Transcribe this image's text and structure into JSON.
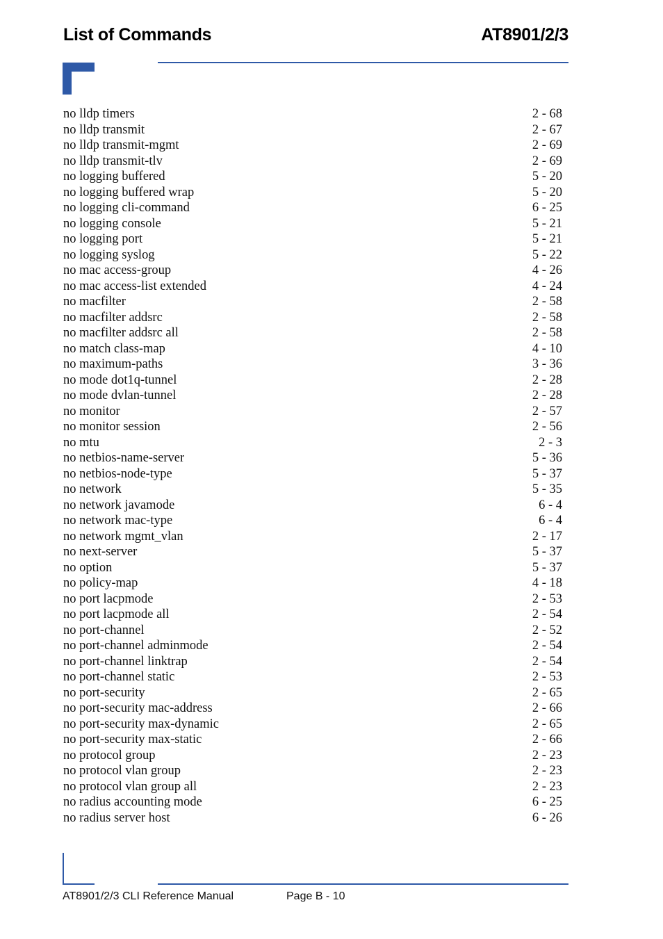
{
  "header": {
    "title": "List of Commands",
    "model": "AT8901/2/3"
  },
  "colors": {
    "accent": "#2e59a7"
  },
  "commands": [
    {
      "name": "no lldp timers",
      "page": "2 - 68"
    },
    {
      "name": "no lldp transmit",
      "page": "2 - 67"
    },
    {
      "name": "no lldp transmit-mgmt",
      "page": "2 - 69"
    },
    {
      "name": "no lldp transmit-tlv",
      "page": "2 - 69"
    },
    {
      "name": "no logging buffered",
      "page": "5 - 20"
    },
    {
      "name": "no logging buffered wrap",
      "page": "5 - 20"
    },
    {
      "name": "no logging cli-command",
      "page": "6 - 25"
    },
    {
      "name": "no logging console",
      "page": "5 - 21"
    },
    {
      "name": "no logging port",
      "page": "5 - 21"
    },
    {
      "name": "no logging syslog",
      "page": "5 - 22"
    },
    {
      "name": "no mac access-group",
      "page": "4 - 26"
    },
    {
      "name": "no mac access-list extended",
      "page": "4 - 24"
    },
    {
      "name": "no macfilter",
      "page": "2 - 58"
    },
    {
      "name": "no macfilter addsrc",
      "page": "2 - 58"
    },
    {
      "name": "no macfilter addsrc all",
      "page": "2 - 58"
    },
    {
      "name": "no match class-map",
      "page": "4 - 10"
    },
    {
      "name": "no maximum-paths",
      "page": "3 - 36"
    },
    {
      "name": "no mode dot1q-tunnel",
      "page": "2 - 28"
    },
    {
      "name": "no mode dvlan-tunnel",
      "page": "2 - 28"
    },
    {
      "name": "no monitor",
      "page": "2 - 57"
    },
    {
      "name": "no monitor session",
      "page": "2 - 56"
    },
    {
      "name": "no mtu",
      "page": "2 - 3"
    },
    {
      "name": "no netbios-name-server",
      "page": "5 - 36"
    },
    {
      "name": "no netbios-node-type",
      "page": "5 - 37"
    },
    {
      "name": "no network",
      "page": "5 - 35"
    },
    {
      "name": "no network javamode",
      "page": "6 - 4"
    },
    {
      "name": "no network mac-type",
      "page": "6 - 4"
    },
    {
      "name": "no network mgmt_vlan",
      "page": "2 - 17"
    },
    {
      "name": "no next-server",
      "page": "5 - 37"
    },
    {
      "name": "no option",
      "page": "5 - 37"
    },
    {
      "name": "no policy-map",
      "page": "4 - 18"
    },
    {
      "name": "no port lacpmode",
      "page": "2 - 53"
    },
    {
      "name": "no port lacpmode all",
      "page": "2 - 54"
    },
    {
      "name": "no port-channel",
      "page": "2 - 52"
    },
    {
      "name": "no port-channel adminmode",
      "page": "2 - 54"
    },
    {
      "name": "no port-channel linktrap",
      "page": "2 - 54"
    },
    {
      "name": "no port-channel static",
      "page": "2 - 53"
    },
    {
      "name": "no port-security",
      "page": "2 - 65"
    },
    {
      "name": "no port-security mac-address",
      "page": "2 - 66"
    },
    {
      "name": "no port-security max-dynamic",
      "page": "2 - 65"
    },
    {
      "name": "no port-security max-static",
      "page": "2 - 66"
    },
    {
      "name": "no protocol group",
      "page": "2 - 23"
    },
    {
      "name": "no protocol vlan group",
      "page": "2 - 23"
    },
    {
      "name": "no protocol vlan group all",
      "page": "2 - 23"
    },
    {
      "name": "no radius accounting mode",
      "page": "6 - 25"
    },
    {
      "name": "no radius server host",
      "page": "6 - 26"
    }
  ],
  "footer": {
    "manual": "AT8901/2/3 CLI Reference Manual",
    "page": "Page B - 10"
  }
}
